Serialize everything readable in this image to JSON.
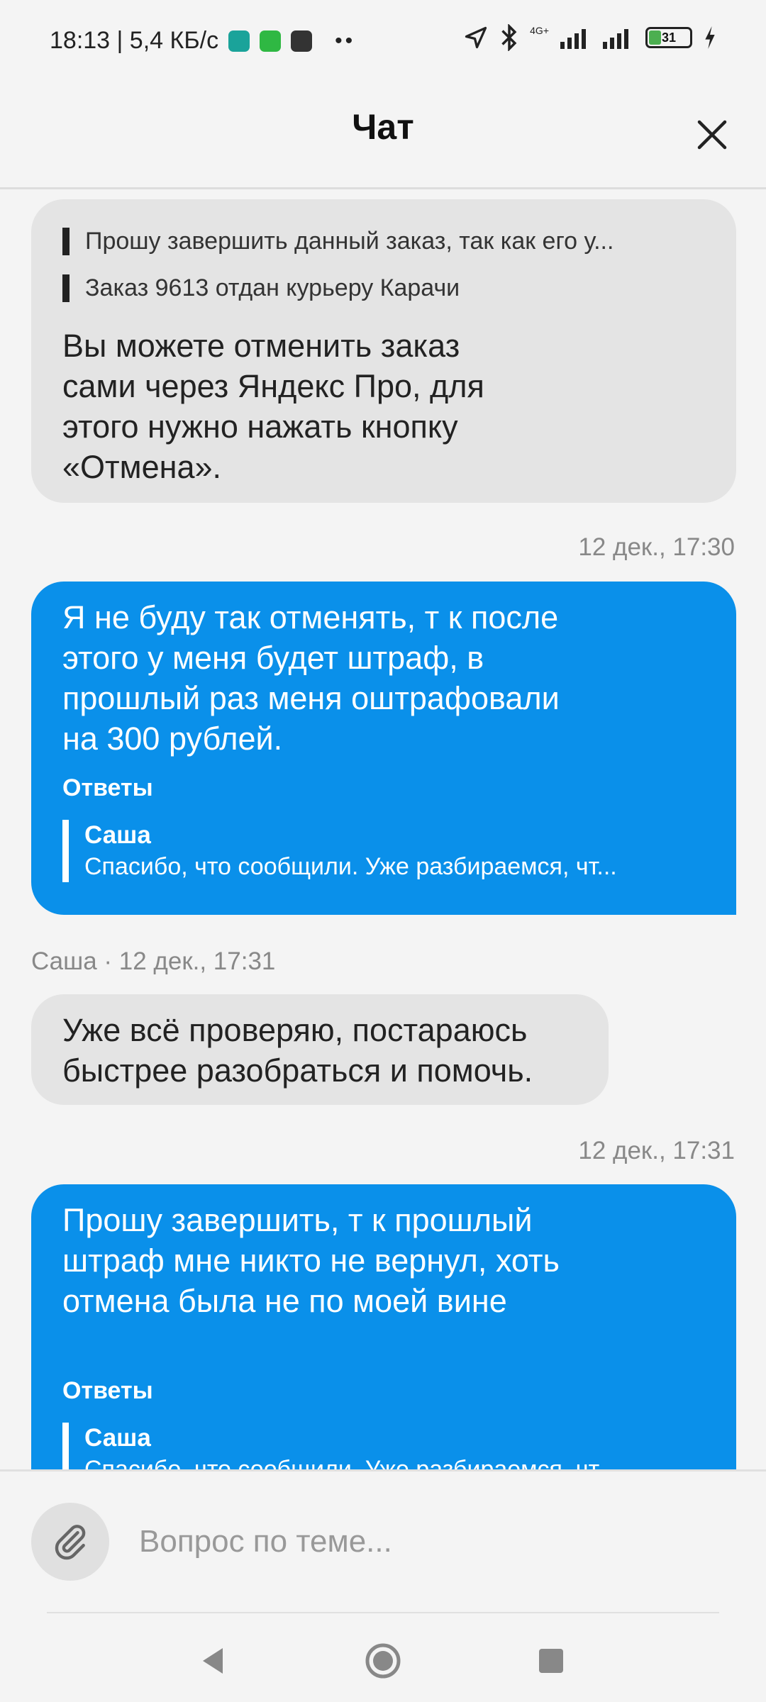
{
  "status_bar": {
    "time_speed": "18:13 | 5,4 КБ/с",
    "dots": "••",
    "network": "4G+",
    "battery": "31",
    "battery_level": 0.31
  },
  "header": {
    "title": "Чат"
  },
  "messages": [
    {
      "direction": "incoming",
      "quotes": [
        "Прошу завершить данный заказ, так как его у...",
        "Заказ 9613 отдан курьеру Карачи"
      ],
      "text": "Вы можете отменить заказ сами через Яндекс Про, для этого нужно нажать кнопку «Отмена»."
    },
    {
      "direction": "outgoing",
      "timestamp": "12 дек., 17:30",
      "text": "Я не буду так отменять, т к после этого у меня будет штраф, в прошлый раз меня оштрафовали на 300 рублей.",
      "replies_title": "Ответы",
      "reply": {
        "author": "Саша",
        "text": "Спасибо, что сообщили. Уже разбираемся, чт..."
      }
    },
    {
      "direction": "incoming",
      "meta": "Саша · 12 дек., 17:31",
      "text": "Уже всё проверяю, постараюсь быстрее разобраться и помочь."
    },
    {
      "direction": "outgoing",
      "timestamp": "12 дек., 17:31",
      "text": "Прошу завершить, т к прошлый штраф мне никто не вернул, хоть отмена была не по моей вине",
      "replies_title": "Ответы",
      "reply": {
        "author": "Саша",
        "text": "Спасибо, что сообщили. Уже разбираемся, чт..."
      }
    }
  ],
  "input": {
    "placeholder": "Вопрос по теме..."
  },
  "colors": {
    "outgoing_bubble": "#0a90ea",
    "incoming_bubble": "#e4e4e4",
    "background": "#f4f4f4"
  },
  "icons": [
    "navigation-arrow-icon",
    "bluetooth-icon",
    "signal-icon",
    "battery-icon",
    "charging-icon",
    "close-icon",
    "paperclip-icon",
    "back-icon",
    "home-icon",
    "recents-icon"
  ]
}
